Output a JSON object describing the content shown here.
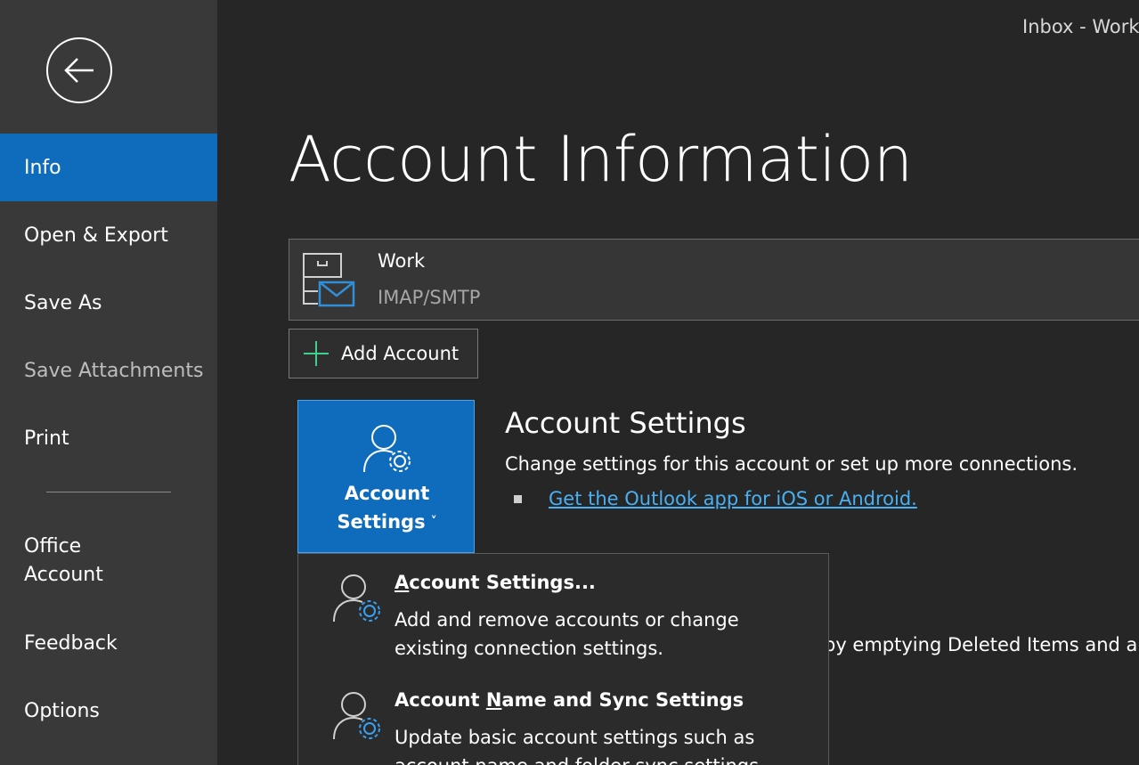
{
  "window": {
    "title": "Inbox - Work"
  },
  "sidebar": {
    "items": [
      {
        "label": "Info",
        "active": true
      },
      {
        "label": "Open & Export"
      },
      {
        "label": "Save As"
      },
      {
        "label": "Save Attachments",
        "disabled": true
      },
      {
        "label": "Print"
      },
      {
        "label": "Office\nAccount"
      },
      {
        "label": "Feedback"
      },
      {
        "label": "Options"
      }
    ]
  },
  "main": {
    "title": "Account Information",
    "account": {
      "name": "Work",
      "type": "IMAP/SMTP"
    },
    "add_account_label": "Add Account",
    "settings_tile": {
      "line1": "Account",
      "line2": "Settings"
    },
    "section": {
      "heading": "Account Settings",
      "description": "Change settings for this account or set up more connections.",
      "link": "Get the Outlook app for iOS or Android."
    },
    "partially_hidden_text": "by emptying Deleted Items and a"
  },
  "dropdown": {
    "items": [
      {
        "title_prefix": "",
        "title_accel": "A",
        "title_rest": "ccount Settings...",
        "description": "Add and remove accounts or change\nexisting connection settings."
      },
      {
        "title_prefix": "Account ",
        "title_accel": "N",
        "title_rest": "ame and Sync Settings",
        "description": "Update basic account settings such as\naccount name and folder sync settings."
      }
    ]
  },
  "colors": {
    "accent": "#0f6cbd",
    "sidebar_bg": "#393939",
    "main_bg": "#262626",
    "link": "#4ab0f2",
    "add_icon": "#3fcf8e",
    "mail_icon": "#2f8fd8",
    "gear_icon": "#3aa0f0"
  }
}
